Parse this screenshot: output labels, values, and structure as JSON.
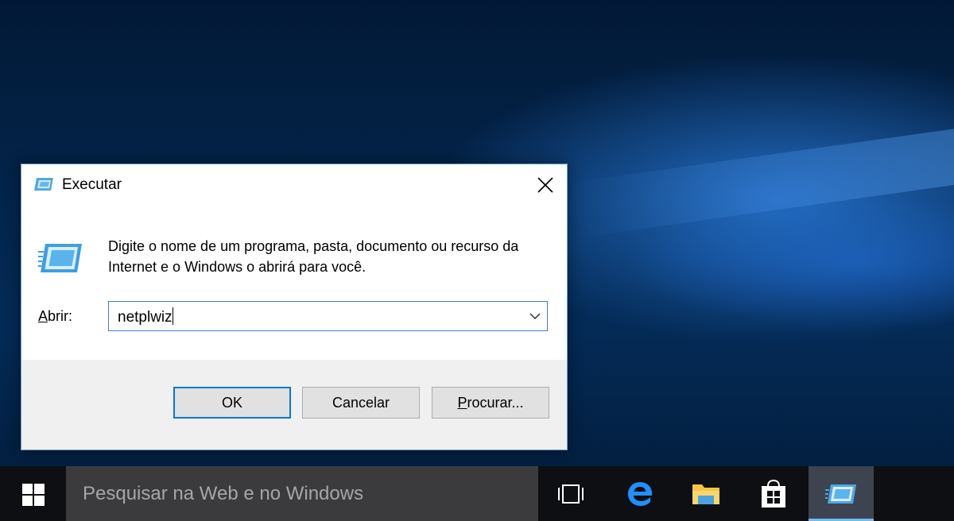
{
  "dialog": {
    "title": "Executar",
    "description": "Digite o nome de um programa, pasta, documento ou recurso da Internet e o Windows o abrirá para você.",
    "open_label_accel": "A",
    "open_label_rest": "brir:",
    "input_value": "netplwiz",
    "buttons": {
      "ok": "OK",
      "cancel": "Cancelar",
      "browse_accel": "P",
      "browse_rest": "rocurar..."
    }
  },
  "taskbar": {
    "search_placeholder": "Pesquisar na Web e no Windows",
    "items": [
      "task-view",
      "edge",
      "file-explorer",
      "store",
      "run"
    ],
    "active_item": "run"
  },
  "colors": {
    "accent": "#0078d7",
    "taskbar": "#0e0f12",
    "search_box": "#3b3b3d",
    "dialog_footer": "#f0f0f0"
  }
}
